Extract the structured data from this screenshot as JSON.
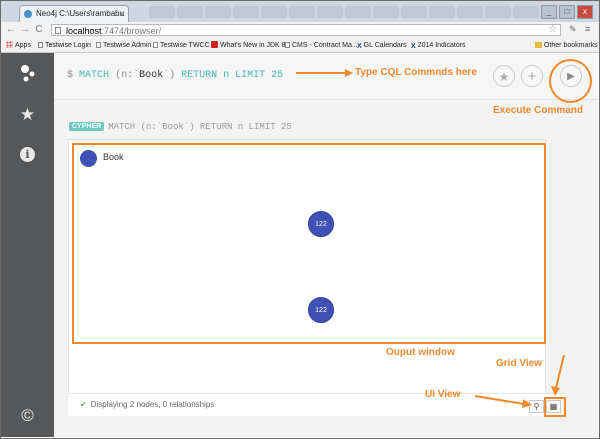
{
  "browser": {
    "tab_title": "Neo4j C:\\Users\\rambabu",
    "tab_close": "×",
    "url_host": "localhost",
    "url_path": ":7474/browser/",
    "bookmarks": [
      "Apps",
      "Testwise Login",
      "Testwise Admin",
      "Testwise TWCC",
      "What's New in JDK 8",
      "CMS - Contract Ma...",
      "GL Calendars",
      "2014  Indicators",
      "Other bookmarks"
    ],
    "back_glyph": "←",
    "forward_glyph": "→",
    "reload_glyph": "C",
    "star_glyph": "☆",
    "menu_glyph": "≡"
  },
  "editor": {
    "prompt_symbol": "$",
    "query_keyword1": "MATCH",
    "query_pattern_open": "(n:`",
    "query_label": "Book",
    "query_pattern_close": "`)",
    "query_keyword2": "RETURN n LIMIT 25",
    "favorite_glyph": "★",
    "add_glyph": "+",
    "run_glyph": "▶"
  },
  "result": {
    "badge": "CYPHER",
    "query_text": "MATCH (n:`Book`) RETURN n LIMIT 25",
    "legend_label": "Book",
    "nodes": [
      {
        "label": "122"
      },
      {
        "label": "122"
      }
    ],
    "status_text": "Displaying 2 nodes, 0 relationships",
    "status_check": "✔"
  },
  "sidebar": {
    "favorites_glyph": "★",
    "info_glyph": "i",
    "copyright_glyph": "©"
  },
  "annotations": {
    "type_cql": "Type CQL Commnds here",
    "execute": "Execute Command",
    "output": "Ouput window",
    "grid_view": "Grid View",
    "ui_view": "UI View"
  },
  "colors": {
    "annotation": "#f0892d",
    "node": "#3f51b5",
    "sidebar": "#555759",
    "cypher_keyword": "#43b7b0"
  }
}
